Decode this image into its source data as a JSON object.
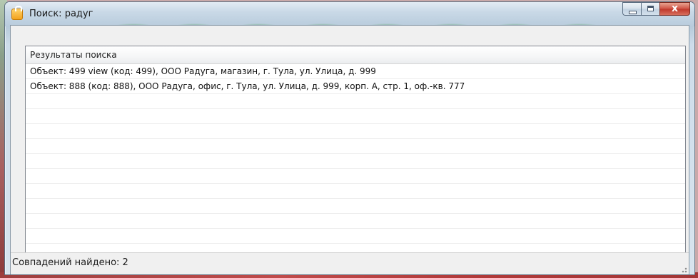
{
  "window": {
    "title": "Поиск: радуг",
    "close_glyph": "x",
    "icon": "lock-icon"
  },
  "results": {
    "header": "Результаты поиска",
    "rows": [
      "Объект: 499 view (код: 499), ООО Радуга, магазин, г. Тула, ул. Улица, д. 999",
      "Объект: 888 (код: 888), ООО Радуга, офис, г. Тула, ул. Улица, д. 999, корп. А, стр. 1, оф.-кв. 777",
      "",
      "",
      "",
      "",
      "",
      "",
      "",
      "",
      "",
      "",
      ""
    ]
  },
  "status": {
    "text": "Совпадений найдено: 2"
  }
}
